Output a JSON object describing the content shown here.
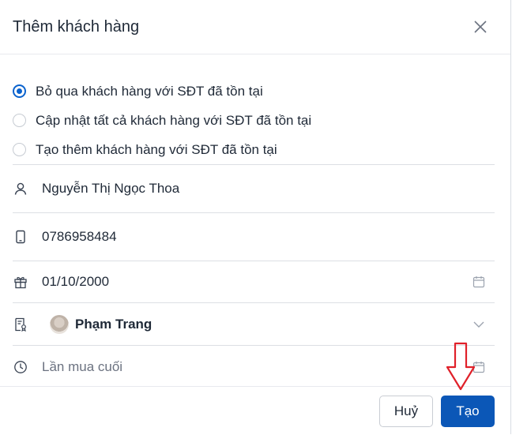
{
  "dialog": {
    "title": "Thêm khách hàng",
    "close_icon": "close-icon"
  },
  "options": [
    {
      "label": "Bỏ qua khách hàng với SĐT đã tồn tại",
      "checked": true
    },
    {
      "label": "Cập nhật tất cả khách hàng với SĐT đã tồn tại",
      "checked": false
    },
    {
      "label": "Tạo thêm khách hàng với SĐT đã tồn tại",
      "checked": false
    }
  ],
  "fields": {
    "name": {
      "icon": "person-icon",
      "value": "Nguyễn Thị Ngọc Thoa"
    },
    "phone": {
      "icon": "phone-icon",
      "value": "0786958484"
    },
    "birthday": {
      "icon": "gift-icon",
      "value": "01/10/2000",
      "right_icon": "calendar-icon"
    },
    "staff": {
      "icon": "staff-badge-icon",
      "value": "Phạm Trang",
      "right_icon": "chevron-down-icon"
    },
    "last_purchase": {
      "icon": "clock-icon",
      "placeholder": "Lần mua cuối",
      "right_icon": "calendar-icon"
    }
  },
  "footer": {
    "cancel_label": "Huỷ",
    "create_label": "Tạo"
  },
  "colors": {
    "primary": "#0b57b7",
    "radio_checked": "#0b63ce",
    "annotation_arrow": "#e0212a"
  }
}
